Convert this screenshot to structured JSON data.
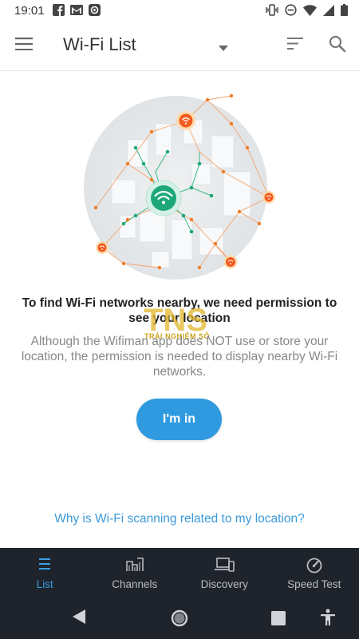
{
  "status_bar": {
    "time": "19:01",
    "left_icons": [
      "facebook-icon",
      "gmail-icon",
      "app-icon"
    ],
    "right_icons": [
      "vibrate-icon",
      "dnd-icon",
      "wifi-icon",
      "signal-icon",
      "battery-icon"
    ]
  },
  "app_bar": {
    "title": "Wi-Fi List",
    "icons": [
      "hamburger-icon",
      "dropdown-arrow-icon",
      "sort-icon",
      "search-icon"
    ]
  },
  "permission": {
    "heading": "To find Wi-Fi networks nearby, we need permission to see your location",
    "body": "Although the Wifiman app does NOT use or store your location, the permission is needed to display nearby Wi-Fi networks.",
    "button_label": "I'm in",
    "link_text": "Why is Wi-Fi scanning related to my location?"
  },
  "watermark": {
    "brand": "TNS",
    "subtitle": "TRẢI NGHIỆM SỐ"
  },
  "bottom_nav": {
    "items": [
      {
        "label": "List",
        "icon": "list-icon",
        "active": true
      },
      {
        "label": "Channels",
        "icon": "channels-icon",
        "active": false
      },
      {
        "label": "Discovery",
        "icon": "discovery-icon",
        "active": false
      },
      {
        "label": "Speed Test",
        "icon": "speedometer-icon",
        "active": false
      }
    ]
  },
  "system_nav": {
    "buttons": [
      "back-icon",
      "home-icon",
      "recents-icon",
      "accessibility-icon"
    ]
  },
  "colors": {
    "accent": "#2f9ae0",
    "link": "#3a9ad9",
    "nav_background": "#1f232b",
    "nav_active": "#3a9ee2",
    "hotspot": "#f25a1e",
    "connected": "#1ea87a"
  }
}
